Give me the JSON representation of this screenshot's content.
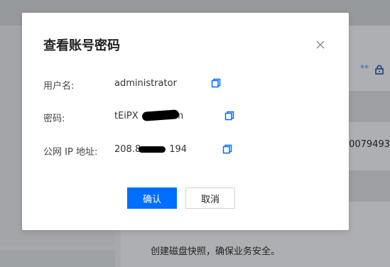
{
  "modal": {
    "title": "查看账号密码",
    "rows": [
      {
        "label": "用户名:",
        "value": "administrator"
      },
      {
        "label": "密码:",
        "value_prefix": "tEiPX",
        "value_suffix": "Wm"
      },
      {
        "label": "公网 IP 地址:",
        "value_prefix": "208.8",
        "value_suffix": "194"
      }
    ],
    "confirm_label": "确认",
    "cancel_label": "取消",
    "icons": {
      "close": "close-icon",
      "copy": "copy-icon"
    }
  },
  "background": {
    "masked_text": "**",
    "partial_number": "20079493",
    "hint_text": "创建磁盘快照，确保业务安全。",
    "icons": {
      "lock": "lock-icon"
    }
  },
  "colors": {
    "primary": "#006eff",
    "overlay": "#a6a8ab"
  }
}
